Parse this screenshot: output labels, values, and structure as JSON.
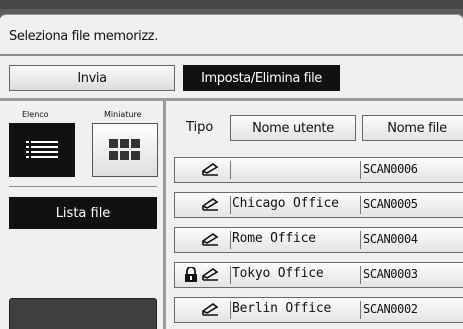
{
  "header": {
    "title": "Seleziona file memorizz."
  },
  "tabs": [
    {
      "label": "Invia",
      "active": false
    },
    {
      "label": "Imposta/Elimina file",
      "active": true
    }
  ],
  "view_toggle": {
    "elenco_label": "Elenco",
    "miniature_label": "Miniature",
    "selected": "Elenco"
  },
  "sidebar": {
    "lista_file_label": "Lista file"
  },
  "table": {
    "tipo_label": "Tipo",
    "columns": [
      "Nome utente",
      "Nome file"
    ],
    "rows": [
      {
        "user": "",
        "file": "SCAN0006",
        "icons": [
          "scan-icon"
        ]
      },
      {
        "user": "Chicago Office",
        "file": "SCAN0005",
        "icons": [
          "scan-icon"
        ]
      },
      {
        "user": "Rome Office",
        "file": "SCAN0004",
        "icons": [
          "scan-icon"
        ]
      },
      {
        "user": "Tokyo Office",
        "file": "SCAN0003",
        "icons": [
          "lock-icon",
          "scan-icon"
        ]
      },
      {
        "user": "Berlin Office",
        "file": "SCAN0002",
        "icons": [
          "scan-icon"
        ]
      }
    ]
  },
  "colors": {
    "selected_bg": "#111111",
    "panel_bg": "#f0f0f0"
  }
}
